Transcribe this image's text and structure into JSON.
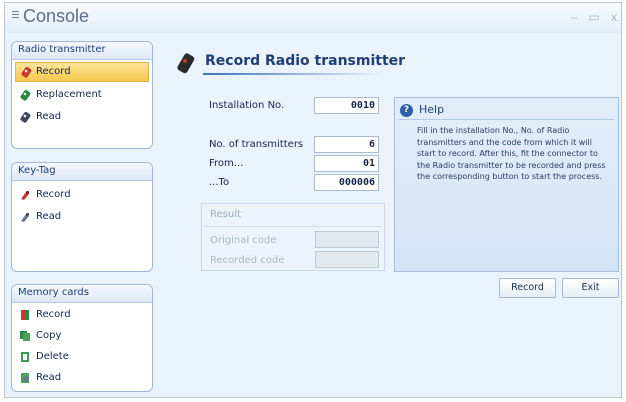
{
  "window": {
    "title": "Console",
    "minimize": "–",
    "maximize": "▭",
    "close": "x"
  },
  "sidebar": {
    "radio": {
      "title": "Radio transmitter",
      "items": [
        "Record",
        "Replacement",
        "Read"
      ]
    },
    "keytag": {
      "title": "Key-Tag",
      "items": [
        "Record",
        "Read"
      ]
    },
    "memory": {
      "title": "Memory cards",
      "items": [
        "Record",
        "Copy",
        "Delete",
        "Read"
      ]
    }
  },
  "main": {
    "title": "Record Radio transmitter",
    "installation_label": "Installation No.",
    "installation_value": "0010",
    "transmitters_label": "No. of transmitters",
    "transmitters_value": "6",
    "from_label": "From...",
    "from_value": "01",
    "to_label": "...To",
    "to_value": "000006",
    "result": {
      "title": "Result",
      "original_label": "Original code",
      "recorded_label": "Recorded code"
    }
  },
  "help": {
    "title": "Help",
    "text": "Fill in the installation No., No. of Radio transmitters and the code from which it will start to record. After this, fit the connector to the Radio transmitter to be recorded and press the corresponding button to start the process."
  },
  "buttons": {
    "record": "Record",
    "exit": "Exit"
  },
  "colors": {
    "accent": "#1f3f73",
    "selection": "#f6c84e",
    "panel_border": "#9fb8d6"
  }
}
